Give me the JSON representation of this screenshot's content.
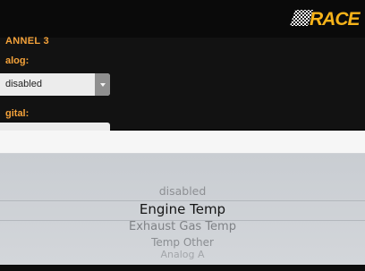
{
  "header": {
    "logo_text": "RACE"
  },
  "settings": {
    "channel_title": "ANNEL 3",
    "analog_label": "alog:",
    "analog_value": "disabled",
    "digital_label": "gital:"
  },
  "picker": {
    "options": [
      {
        "label": "disabled",
        "selected": false
      },
      {
        "label": "Engine Temp",
        "selected": true
      },
      {
        "label": "Exhaust Gas Temp",
        "selected": false
      },
      {
        "label": "Temp Other",
        "selected": false
      },
      {
        "label": "Analog A",
        "selected": false
      }
    ]
  },
  "colors": {
    "accent": "#f4a23a",
    "header_bg": "#0a0a0a",
    "picker_bg": "#cfd2d6"
  }
}
